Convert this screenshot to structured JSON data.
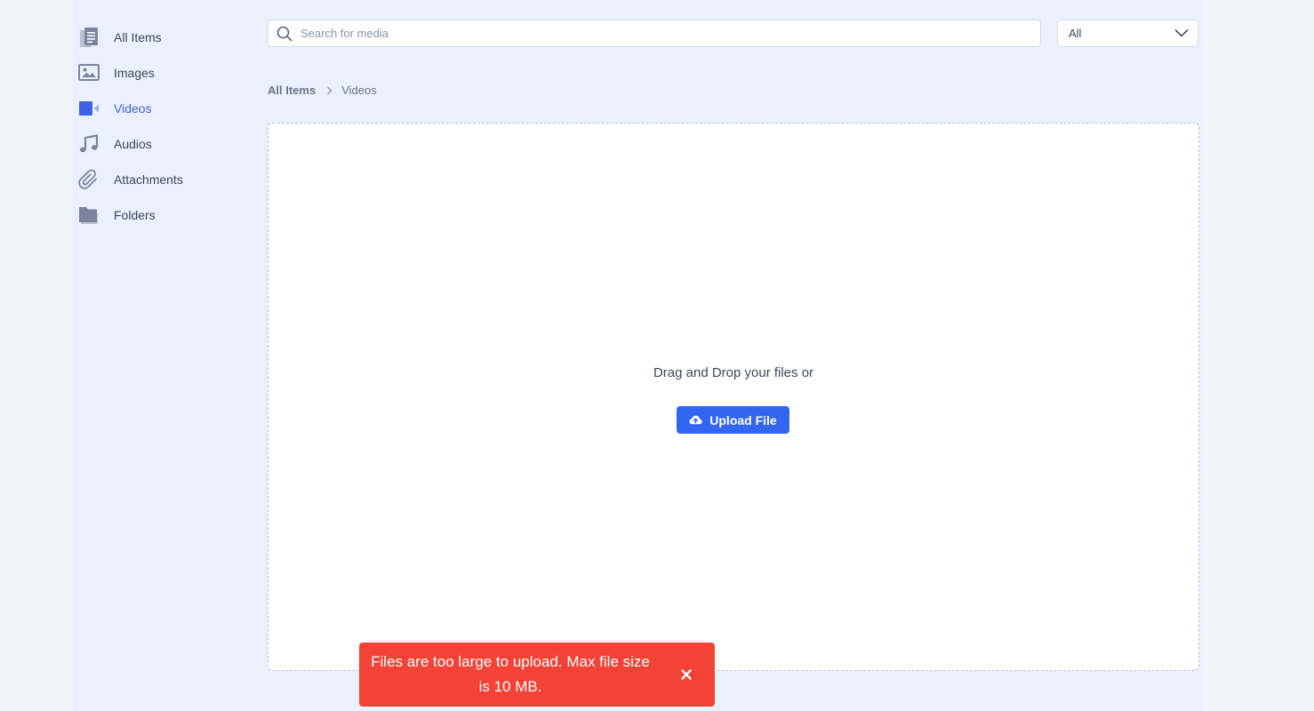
{
  "sidebar": {
    "items": [
      {
        "label": "All Items",
        "icon": "documents-icon",
        "active": false
      },
      {
        "label": "Images",
        "icon": "image-icon",
        "active": false
      },
      {
        "label": "Videos",
        "icon": "video-camera-icon",
        "active": true
      },
      {
        "label": "Audios",
        "icon": "music-note-icon",
        "active": false
      },
      {
        "label": "Attachments",
        "icon": "paperclip-icon",
        "active": false
      },
      {
        "label": "Folders",
        "icon": "folder-icon",
        "active": false
      }
    ]
  },
  "search": {
    "placeholder": "Search for media",
    "value": ""
  },
  "filter": {
    "selected": "All"
  },
  "breadcrumb": {
    "root": "All Items",
    "current": "Videos"
  },
  "dropzone": {
    "prompt": "Drag and Drop your files or",
    "upload_label": "Upload File"
  },
  "toast": {
    "line1": "Files are too large to upload. Max file size",
    "line2": "is 10 MB.",
    "type": "error"
  },
  "colors": {
    "accent": "#3366f0",
    "active_nav": "#3f62e6",
    "error": "#f44336",
    "background": "#ebf1fc",
    "icon_gray": "#7a849c"
  }
}
